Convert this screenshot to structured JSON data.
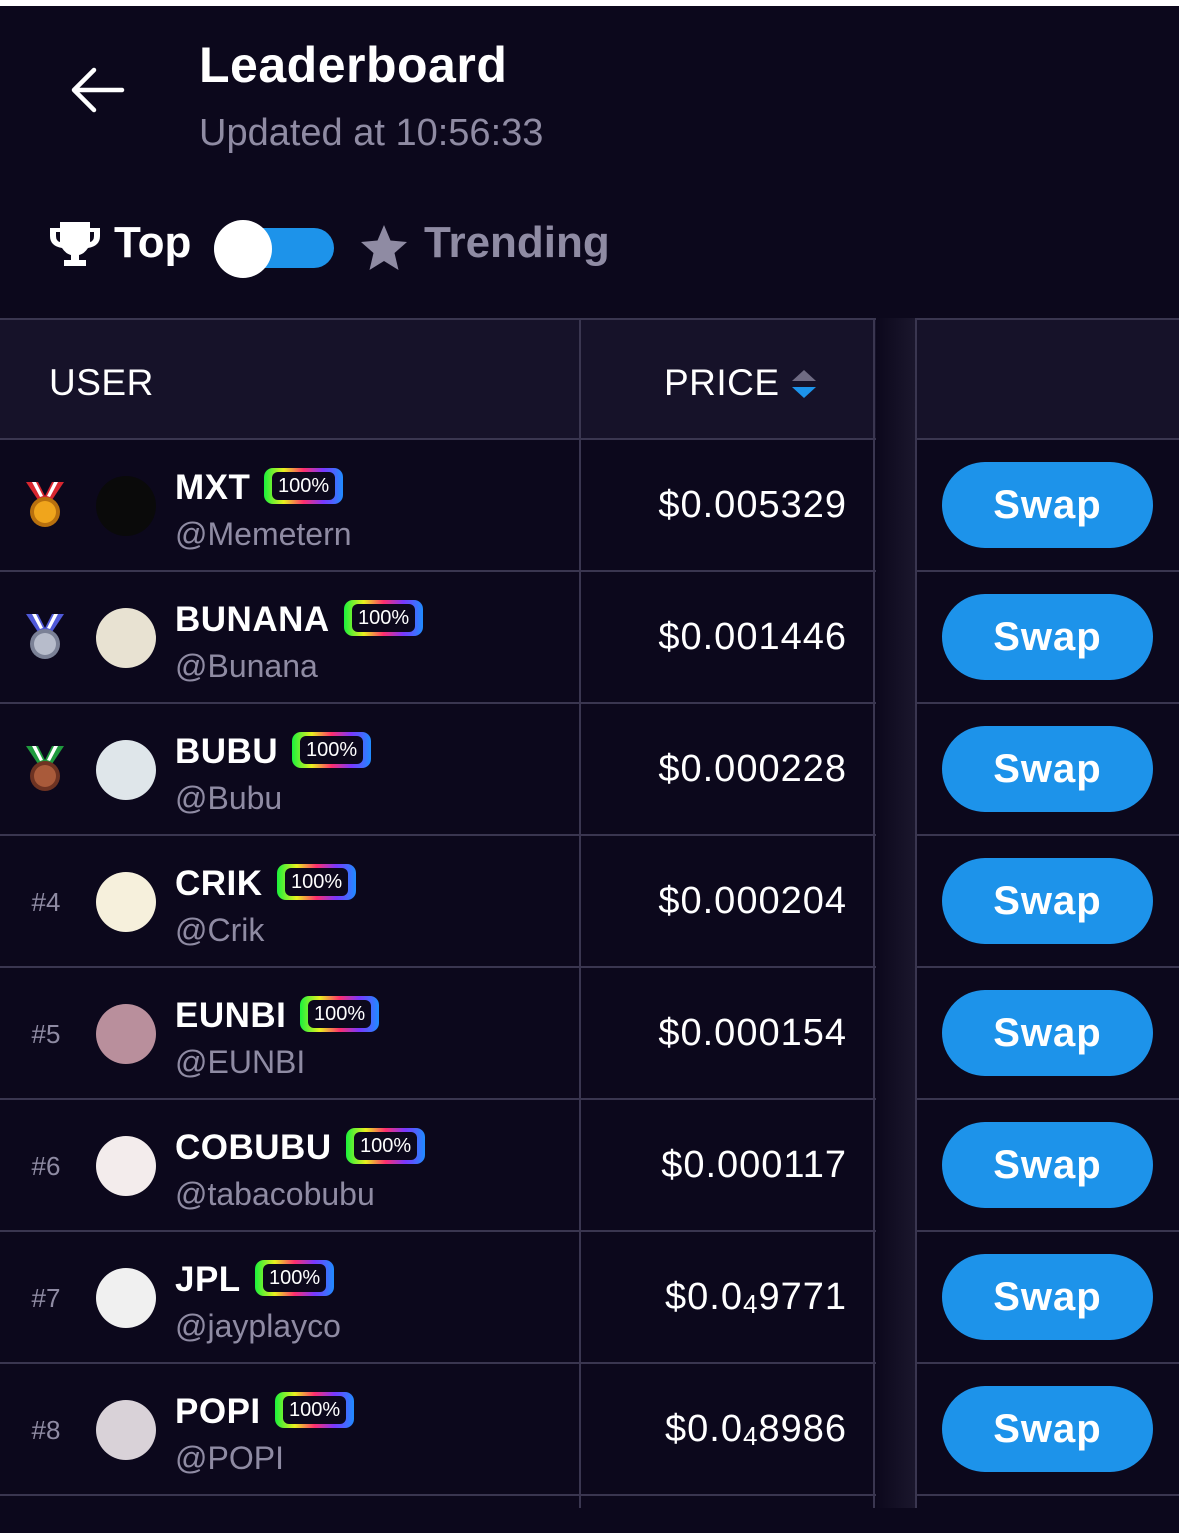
{
  "header": {
    "title": "Leaderboard",
    "subtitle": "Updated at 10:56:33",
    "back_icon": "arrow-left-icon"
  },
  "toggle": {
    "left_label": "Top",
    "left_icon": "trophy-icon",
    "right_label": "Trending",
    "right_icon": "star-icon",
    "selected": "Top"
  },
  "table": {
    "col_user": "USER",
    "col_price": "PRICE",
    "sort_icon": "sort-icon",
    "swap_label": "Swap",
    "rows": [
      {
        "rank": "",
        "medal": "gold",
        "name": "MXT",
        "badge": "100%",
        "handle": "@Memetern",
        "price_prefix": "$0.005329",
        "price_sub": "",
        "price_rest": "",
        "avatar_color": "#0a0a0a"
      },
      {
        "rank": "",
        "medal": "silver",
        "name": "BUNANA",
        "badge": "100%",
        "handle": "@Bunana",
        "price_prefix": "$0.001446",
        "price_sub": "",
        "price_rest": "",
        "avatar_color": "#e8e2d2"
      },
      {
        "rank": "",
        "medal": "bronze",
        "name": "BUBU",
        "badge": "100%",
        "handle": "@Bubu",
        "price_prefix": "$0.000228",
        "price_sub": "",
        "price_rest": "",
        "avatar_color": "#dfe6ea"
      },
      {
        "rank": "#4",
        "medal": "",
        "name": "CRIK",
        "badge": "100%",
        "handle": "@Crik",
        "price_prefix": "$0.000204",
        "price_sub": "",
        "price_rest": "",
        "avatar_color": "#f6f0dc"
      },
      {
        "rank": "#5",
        "medal": "",
        "name": "EUNBI",
        "badge": "100%",
        "handle": "@EUNBI",
        "price_prefix": "$0.000154",
        "price_sub": "",
        "price_rest": "",
        "avatar_color": "#b98f9c"
      },
      {
        "rank": "#6",
        "medal": "",
        "name": "COBUBU",
        "badge": "100%",
        "handle": "@tabacobubu",
        "price_prefix": "$0.000117",
        "price_sub": "",
        "price_rest": "",
        "avatar_color": "#f3ecec"
      },
      {
        "rank": "#7",
        "medal": "",
        "name": "JPL",
        "badge": "100%",
        "handle": "@jayplayco",
        "price_prefix": "$0.0",
        "price_sub": "4",
        "price_rest": "9771",
        "avatar_color": "#f0f0f0"
      },
      {
        "rank": "#8",
        "medal": "",
        "name": "POPI",
        "badge": "100%",
        "handle": "@POPI",
        "price_prefix": "$0.0",
        "price_sub": "4",
        "price_rest": "8986",
        "avatar_color": "#d9d2d8"
      }
    ]
  },
  "colors": {
    "background": "#0c081c",
    "header_row": "#161229",
    "accent": "#1d93ea",
    "muted_text": "#8f8ba3",
    "divider": "#3a3650"
  }
}
